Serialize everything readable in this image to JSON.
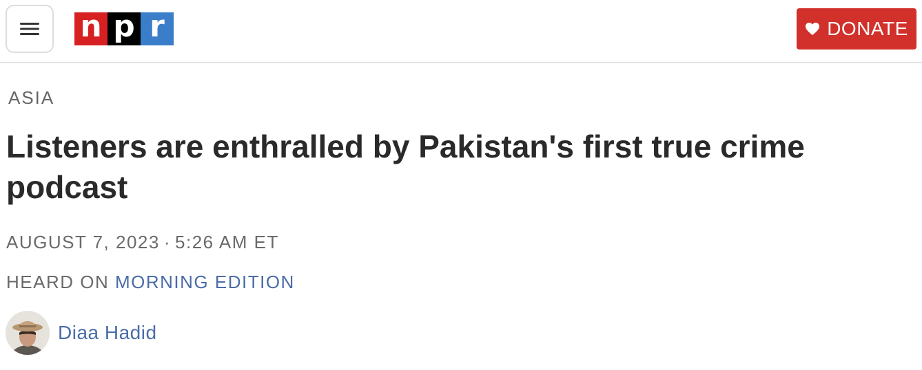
{
  "header": {
    "menu_icon": "hamburger-menu-icon",
    "logo": {
      "letters": [
        "n",
        "p",
        "r"
      ],
      "colors": [
        "#d62021",
        "#000000",
        "#3a7dc9"
      ]
    },
    "donate": {
      "label": "DONATE",
      "icon": "heart-icon",
      "color": "#d1302b"
    }
  },
  "article": {
    "section": "ASIA",
    "title": "Listeners are enthralled by Pakistan's first true crime podcast",
    "date": "AUGUST 7, 2023",
    "separator": "·",
    "time": "5:26 AM ET",
    "heard_on_prefix": "HEARD ON",
    "program": "MORNING EDITION",
    "author": {
      "name": "Diaa Hadid",
      "avatar_icon": "author-avatar"
    }
  },
  "colors": {
    "link": "#4a6ca7",
    "meta_text": "#6a6a6a",
    "headline": "#2a2a2a"
  }
}
